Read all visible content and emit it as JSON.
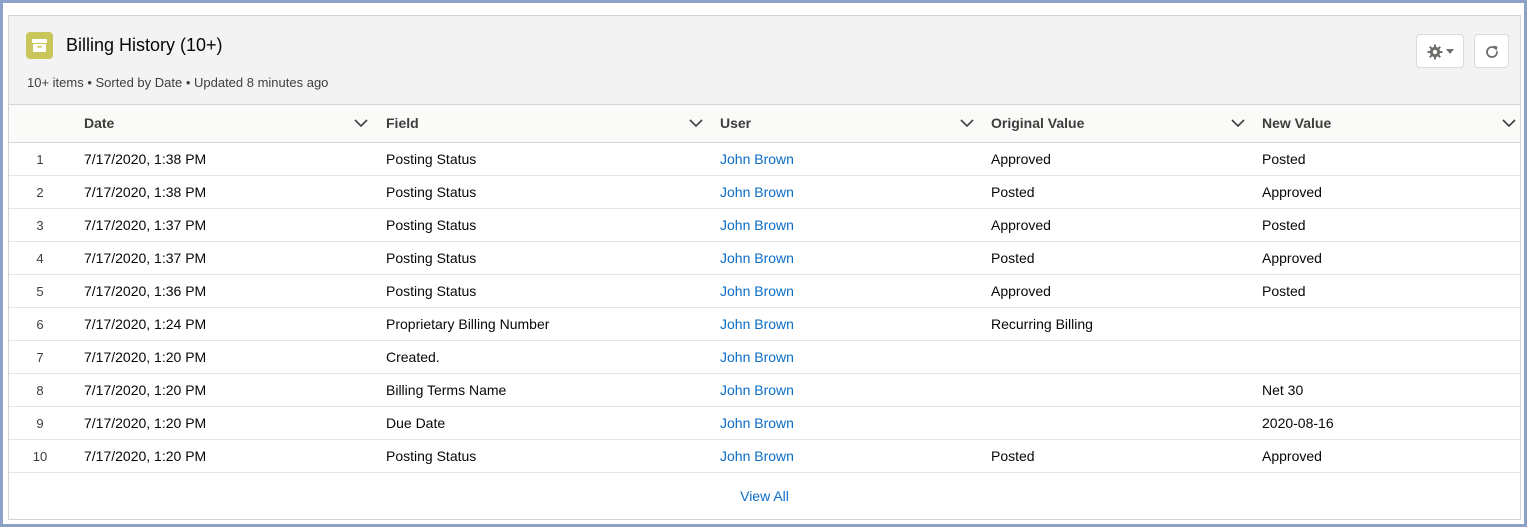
{
  "card": {
    "title": "Billing History (10+)",
    "subtitle": "10+ items • Sorted by Date • Updated 8 minutes ago",
    "icon": "archive-icon",
    "icon_color": "#c9c75c"
  },
  "actions": {
    "settings_icon": "gear-icon",
    "refresh_icon": "refresh-icon"
  },
  "table": {
    "columns": [
      "Date",
      "Field",
      "User",
      "Original Value",
      "New Value"
    ],
    "rows": [
      {
        "num": "1",
        "date": "7/17/2020, 1:38 PM",
        "field": "Posting Status",
        "user": "John Brown",
        "original": "Approved",
        "new": "Posted"
      },
      {
        "num": "2",
        "date": "7/17/2020, 1:38 PM",
        "field": "Posting Status",
        "user": "John Brown",
        "original": "Posted",
        "new": "Approved"
      },
      {
        "num": "3",
        "date": "7/17/2020, 1:37 PM",
        "field": "Posting Status",
        "user": "John Brown",
        "original": "Approved",
        "new": "Posted"
      },
      {
        "num": "4",
        "date": "7/17/2020, 1:37 PM",
        "field": "Posting Status",
        "user": "John Brown",
        "original": "Posted",
        "new": "Approved"
      },
      {
        "num": "5",
        "date": "7/17/2020, 1:36 PM",
        "field": "Posting Status",
        "user": "John Brown",
        "original": "Approved",
        "new": "Posted"
      },
      {
        "num": "6",
        "date": "7/17/2020, 1:24 PM",
        "field": "Proprietary Billing Number",
        "user": "John Brown",
        "original": "Recurring Billing",
        "new": ""
      },
      {
        "num": "7",
        "date": "7/17/2020, 1:20 PM",
        "field": "Created.",
        "user": "John Brown",
        "original": "",
        "new": ""
      },
      {
        "num": "8",
        "date": "7/17/2020, 1:20 PM",
        "field": "Billing Terms Name",
        "user": "John Brown",
        "original": "",
        "new": "Net 30"
      },
      {
        "num": "9",
        "date": "7/17/2020, 1:20 PM",
        "field": "Due Date",
        "user": "John Brown",
        "original": "",
        "new": "2020-08-16"
      },
      {
        "num": "10",
        "date": "7/17/2020, 1:20 PM",
        "field": "Posting Status",
        "user": "John Brown",
        "original": "Posted",
        "new": "Approved"
      }
    ]
  },
  "footer": {
    "view_all": "View All"
  },
  "colors": {
    "link": "#0b6dc6",
    "header_bg": "#f3f3f3"
  }
}
